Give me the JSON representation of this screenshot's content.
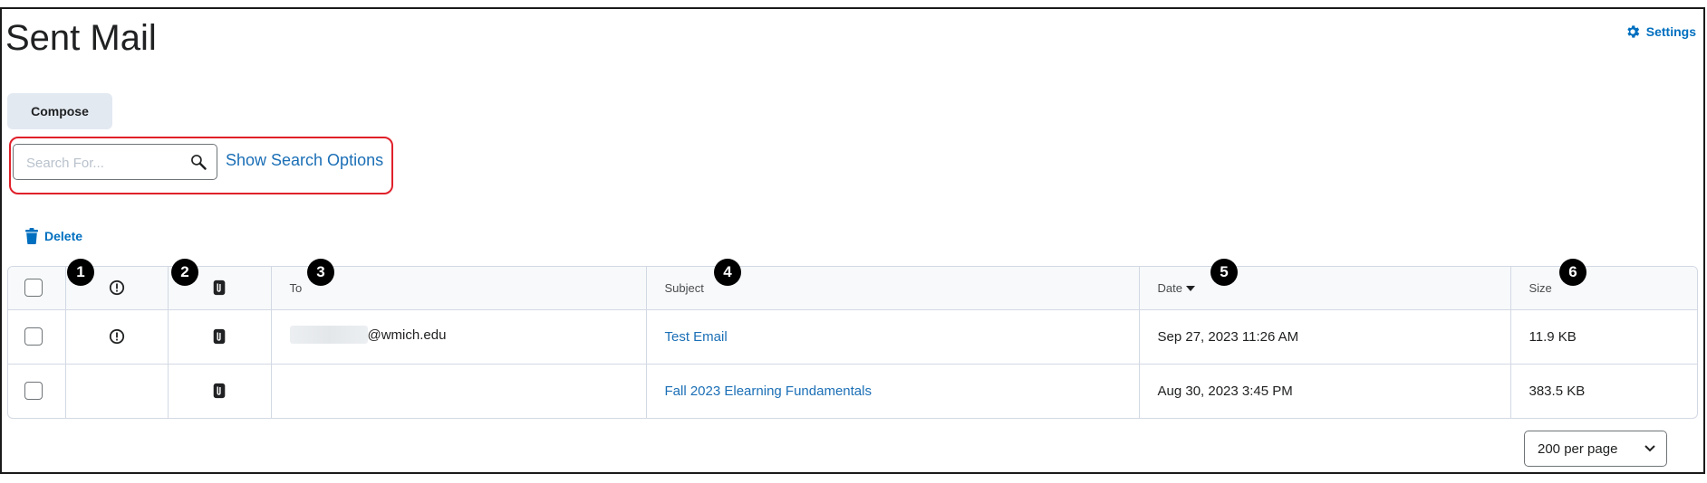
{
  "header": {
    "title": "Sent Mail",
    "settings_label": "Settings"
  },
  "toolbar": {
    "compose_label": "Compose",
    "delete_label": "Delete"
  },
  "search": {
    "placeholder": "Search For...",
    "options_label": "Show Search Options"
  },
  "table": {
    "headers": {
      "to": "To",
      "subject": "Subject",
      "date": "Date",
      "size": "Size"
    },
    "rows": [
      {
        "to_visible": "@wmich.edu",
        "subject": "Test Email",
        "date": "Sep 27, 2023 11:26 AM",
        "size": "11.9 KB",
        "important": true,
        "attachment": true
      },
      {
        "to_visible": "",
        "subject": "Fall 2023 Elearning Fundamentals",
        "date": "Aug 30, 2023 3:45 PM",
        "size": "383.5 KB",
        "important": false,
        "attachment": true
      }
    ]
  },
  "pagination": {
    "per_page_label": "200 per page"
  },
  "callouts": [
    "1",
    "2",
    "3",
    "4",
    "5",
    "6"
  ],
  "colors": {
    "link": "#1b6fb6",
    "accent": "#006fbf",
    "highlight": "#e0202a",
    "compose_bg": "#e3e9f1"
  }
}
